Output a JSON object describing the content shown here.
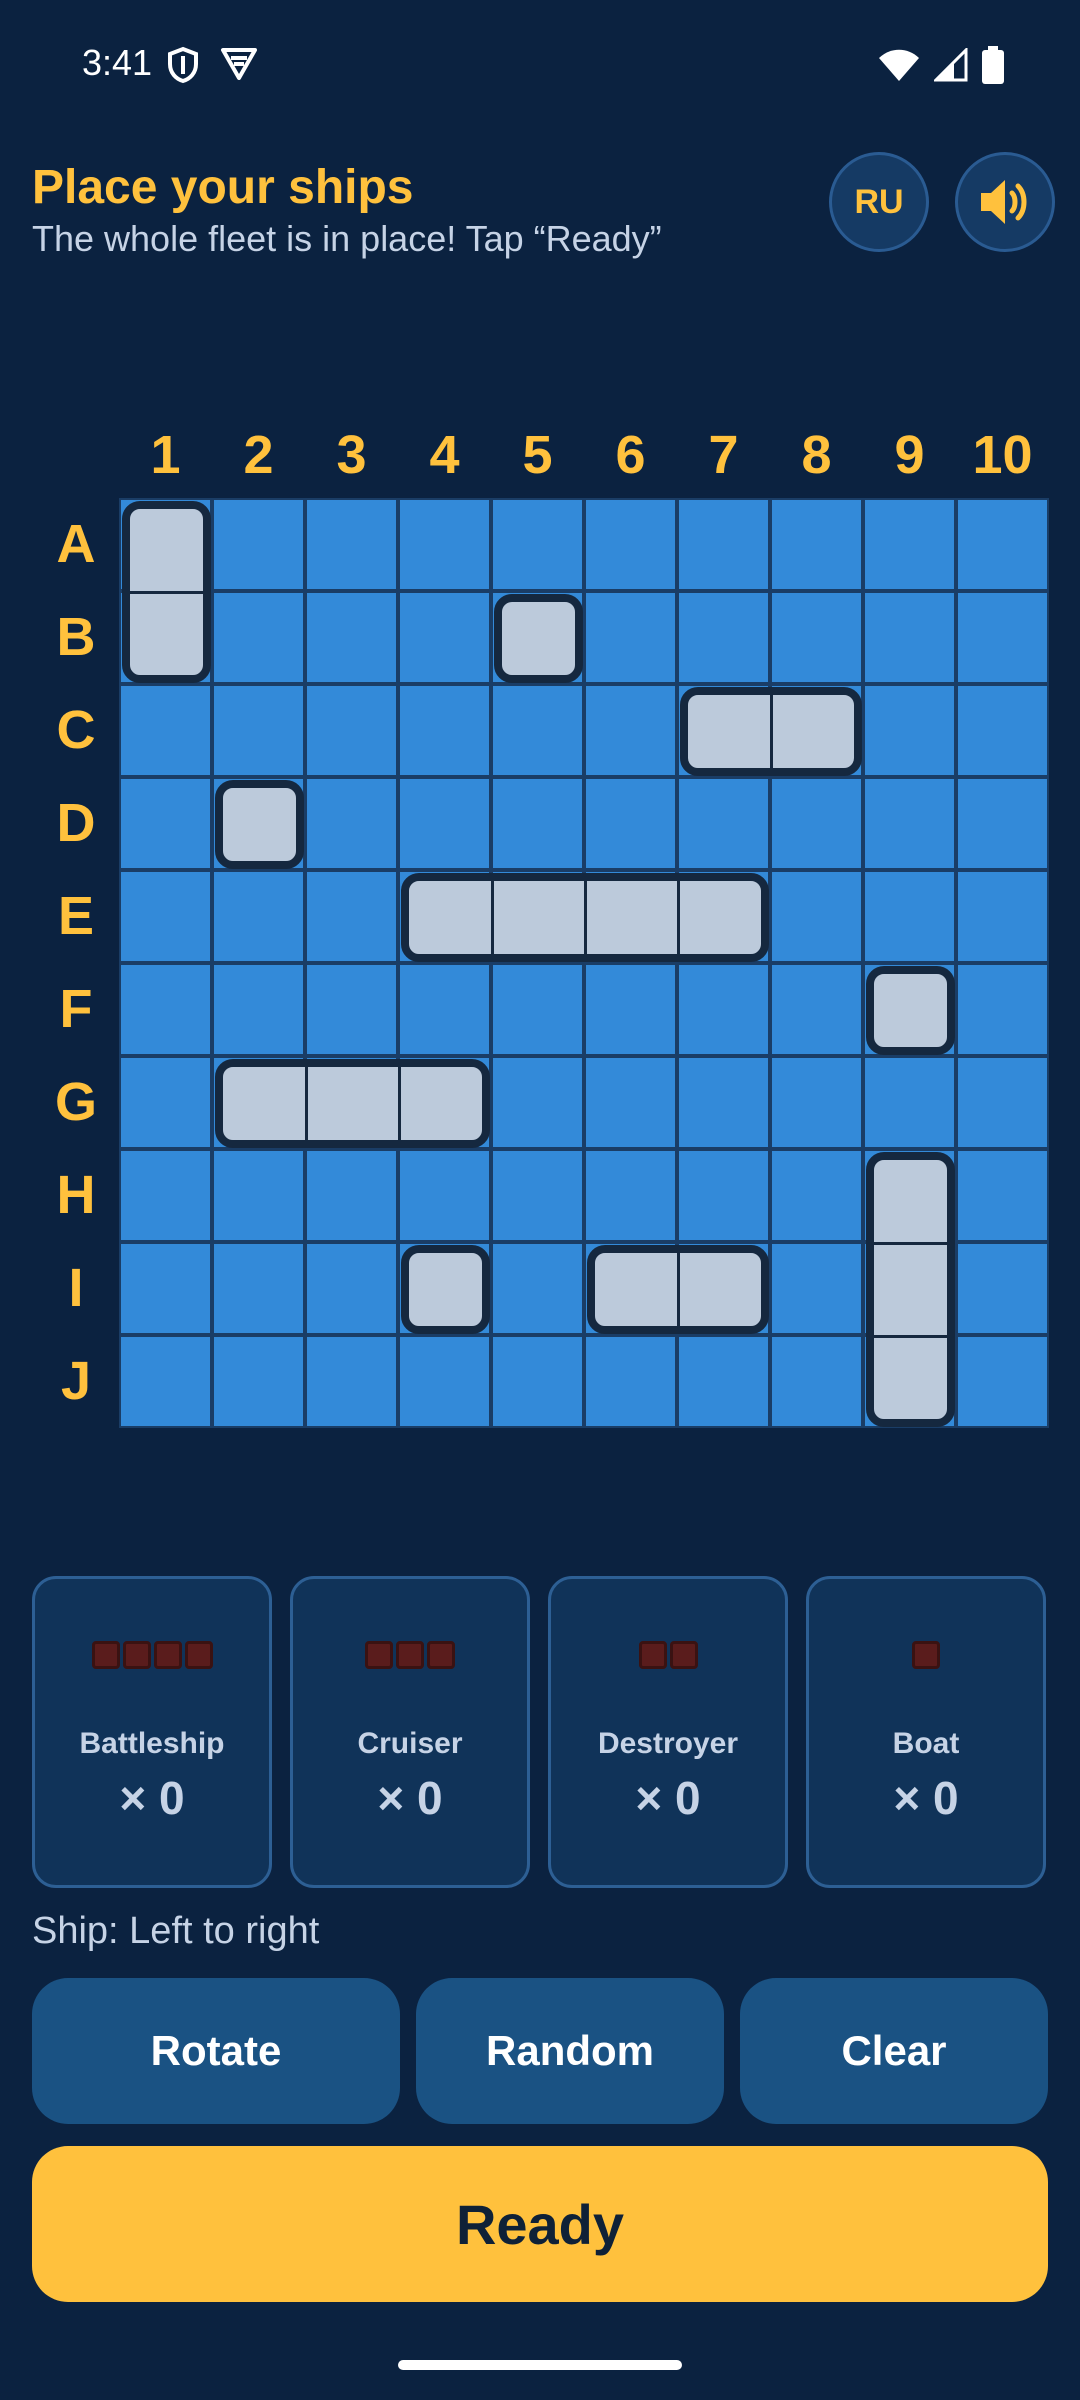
{
  "status_bar": {
    "time": "3:41",
    "left_icons": [
      "shield-icon",
      "vpn-icon"
    ],
    "right_icons": [
      "wifi-icon",
      "signal-icon",
      "battery-icon"
    ]
  },
  "header": {
    "title": "Place your ships",
    "subtitle": "The whole fleet is in place! Tap “Ready”",
    "language_button": "RU",
    "sound_icon": "speaker-icon"
  },
  "board": {
    "columns": [
      "1",
      "2",
      "3",
      "4",
      "5",
      "6",
      "7",
      "8",
      "9",
      "10"
    ],
    "rows": [
      "A",
      "B",
      "C",
      "D",
      "E",
      "F",
      "G",
      "H",
      "I",
      "J"
    ],
    "ships": [
      {
        "row": 0,
        "col": 0,
        "length": 2,
        "orientation": "vertical"
      },
      {
        "row": 1,
        "col": 4,
        "length": 1,
        "orientation": "horizontal"
      },
      {
        "row": 2,
        "col": 6,
        "length": 2,
        "orientation": "horizontal"
      },
      {
        "row": 3,
        "col": 1,
        "length": 1,
        "orientation": "horizontal"
      },
      {
        "row": 4,
        "col": 3,
        "length": 4,
        "orientation": "horizontal"
      },
      {
        "row": 5,
        "col": 8,
        "length": 1,
        "orientation": "horizontal"
      },
      {
        "row": 6,
        "col": 1,
        "length": 3,
        "orientation": "horizontal"
      },
      {
        "row": 7,
        "col": 8,
        "length": 3,
        "orientation": "vertical"
      },
      {
        "row": 8,
        "col": 3,
        "length": 1,
        "orientation": "horizontal"
      },
      {
        "row": 8,
        "col": 5,
        "length": 2,
        "orientation": "horizontal"
      }
    ]
  },
  "fleet": [
    {
      "name": "Battleship",
      "count": "× 0",
      "size": 4
    },
    {
      "name": "Cruiser",
      "count": "× 0",
      "size": 3
    },
    {
      "name": "Destroyer",
      "count": "× 0",
      "size": 2
    },
    {
      "name": "Boat",
      "count": "× 0",
      "size": 1
    }
  ],
  "ship_direction": "Ship: Left to right",
  "buttons": {
    "rotate": "Rotate",
    "random": "Random",
    "clear": "Clear",
    "ready": "Ready"
  },
  "colors": {
    "background": "#0b2240",
    "accent": "#ffc13d",
    "water": "#338ad9",
    "ship": "#bccadb"
  }
}
